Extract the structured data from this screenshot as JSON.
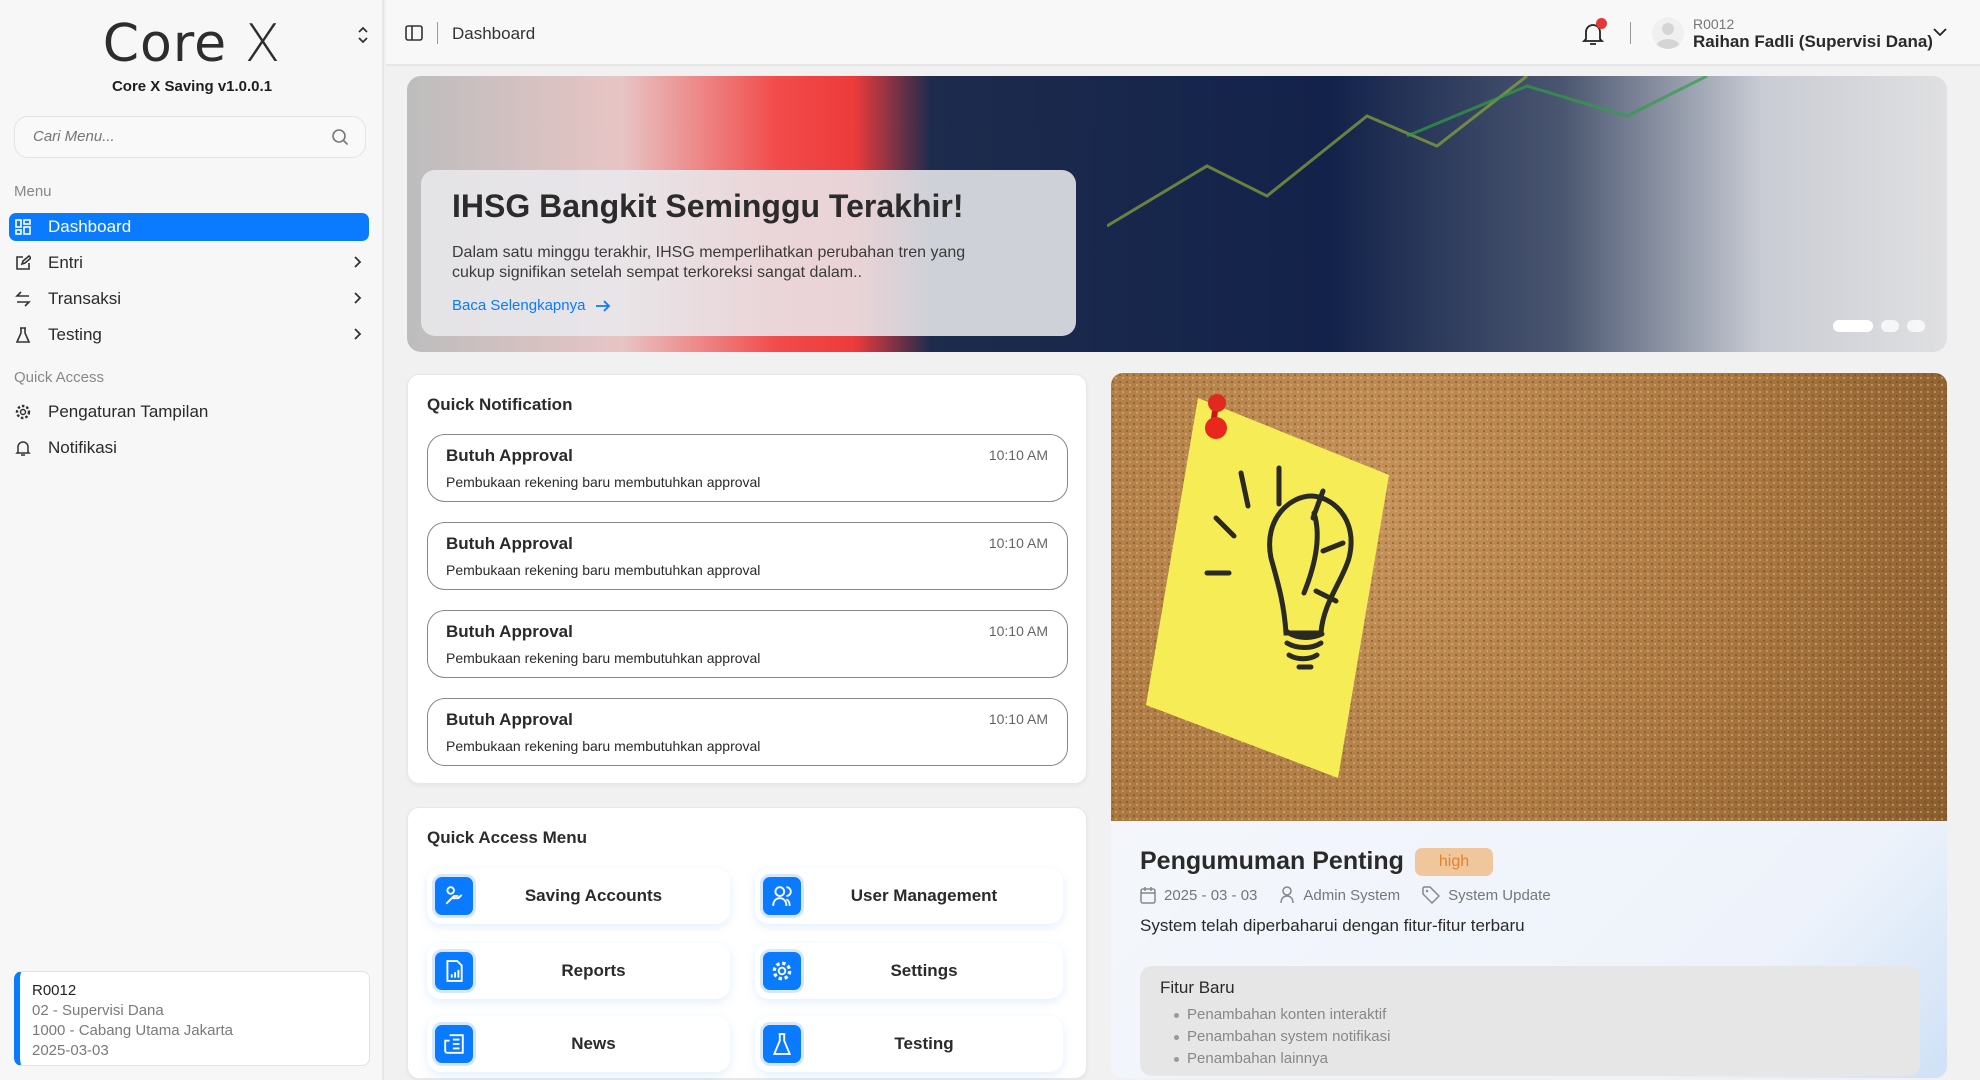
{
  "sidebar": {
    "logo": {
      "core": "Core",
      "x": "X"
    },
    "version": "Core X Saving v1.0.0.1",
    "search_placeholder": "Cari Menu...",
    "menu_label": "Menu",
    "items": [
      {
        "label": "Dashboard",
        "icon": "dashboard-icon",
        "active": true
      },
      {
        "label": "Entri",
        "icon": "edit-icon"
      },
      {
        "label": "Transaksi",
        "icon": "transfer-icon"
      },
      {
        "label": "Testing",
        "icon": "flask-icon"
      }
    ],
    "quick_label": "Quick Access",
    "quick_items": [
      {
        "label": "Pengaturan Tampilan",
        "icon": "gear-icon"
      },
      {
        "label": "Notifikasi",
        "icon": "bell-icon"
      }
    ],
    "user_card": {
      "id": "R0012",
      "role": "02 - Supervisi Dana",
      "branch": "1000 - Cabang Utama Jakarta",
      "date": "2025-03-03"
    }
  },
  "header": {
    "title": "Dashboard",
    "user_code": "R0012",
    "user_name": "Raihan Fadli (Supervisi Dana)",
    "has_notification": true
  },
  "banner": {
    "title": "IHSG Bangkit Seminggu Terakhir!",
    "text": "Dalam satu minggu terakhir, IHSG memperlihatkan perubahan tren yang cukup signifikan setelah sempat terkoreksi sangat dalam..",
    "link": "Baca Selengkapnya",
    "slides": 3,
    "active_slide": 1
  },
  "notifications": {
    "title": "Quick Notification",
    "items": [
      {
        "title": "Butuh Approval",
        "time": "10:10 AM",
        "desc": "Pembukaan rekening baru membutuhkan approval"
      },
      {
        "title": "Butuh Approval",
        "time": "10:10 AM",
        "desc": "Pembukaan rekening baru membutuhkan approval"
      },
      {
        "title": "Butuh Approval",
        "time": "10:10 AM",
        "desc": "Pembukaan rekening baru membutuhkan approval"
      },
      {
        "title": "Butuh Approval",
        "time": "10:10 AM",
        "desc": "Pembukaan rekening baru membutuhkan approval"
      }
    ]
  },
  "quick_access": {
    "title": "Quick Access Menu",
    "items": [
      {
        "label": "Saving Accounts",
        "icon": "saving-icon"
      },
      {
        "label": "User Management",
        "icon": "users-icon"
      },
      {
        "label": "Reports",
        "icon": "report-icon"
      },
      {
        "label": "Settings",
        "icon": "gear-icon"
      },
      {
        "label": "News",
        "icon": "news-icon"
      },
      {
        "label": "Testing",
        "icon": "flask-icon"
      }
    ]
  },
  "announcement": {
    "title": "Pengumuman Penting",
    "priority": "high",
    "date": "2025 - 03 - 03",
    "author": "Admin System",
    "category": "System Update",
    "desc": "System telah diperbaharui dengan fitur-fitur terbaru",
    "features_title": "Fitur Baru",
    "features": [
      "Penambahan konten interaktif",
      "Penambahan system notifikasi",
      "Penambahan lainnya"
    ]
  },
  "colors": {
    "accent": "#0a7bff",
    "badge_bg": "#f0c79d",
    "badge_text": "#e5822e",
    "notif_dot": "#e53935"
  }
}
